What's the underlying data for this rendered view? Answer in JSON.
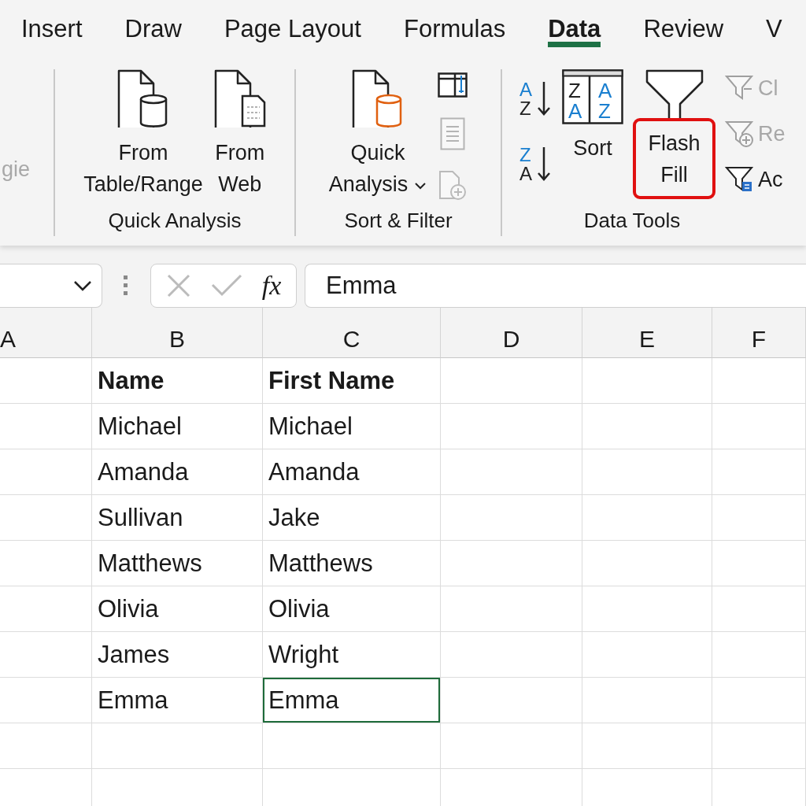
{
  "tabs": [
    {
      "label": "Insert",
      "selected": false
    },
    {
      "label": "Draw",
      "selected": false
    },
    {
      "label": "Page Layout",
      "selected": false
    },
    {
      "label": "Formulas",
      "selected": false
    },
    {
      "label": "Data",
      "selected": true
    },
    {
      "label": "Review",
      "selected": false
    },
    {
      "label": "V",
      "selected": false
    }
  ],
  "ribbon": {
    "left_fragment": {
      "label": "gie",
      "disabled": true
    },
    "groups": [
      {
        "label": "Quick Analysis",
        "buttons": [
          {
            "kind": "table",
            "lines": [
              "From",
              "Table/Range"
            ],
            "dropdown": false
          },
          {
            "kind": "web",
            "lines": [
              "From",
              "Web"
            ],
            "dropdown": false
          }
        ]
      },
      {
        "label": "Sort & Filter",
        "buttons": [
          {
            "kind": "query",
            "lines": [
              "Quick",
              "Analysis"
            ],
            "dropdown": true
          }
        ],
        "small_icons": [
          {
            "kind": "columns",
            "disabled": false
          },
          {
            "kind": "sheet",
            "disabled": true
          },
          {
            "kind": "refresh",
            "disabled": true
          }
        ]
      }
    ],
    "data_tools": {
      "label": "Data Tools",
      "sort_ascending": [
        "A",
        "Z"
      ],
      "sort_descending": [
        "Z",
        "A"
      ],
      "sort_button": {
        "icon_letters": [
          "Z",
          "A",
          "A",
          "Z"
        ],
        "label": "Sort"
      },
      "flash_fill": {
        "lines": [
          "Flash",
          "Fill"
        ],
        "highlighted": true
      },
      "filter_commands": [
        {
          "kind": "clear",
          "label": "Cl",
          "disabled": true
        },
        {
          "kind": "reapply",
          "label": "Re",
          "disabled": true
        },
        {
          "kind": "advanced",
          "label": "Ac",
          "disabled": false
        }
      ]
    }
  },
  "formula_bar": {
    "fx": "fx",
    "value": "Emma"
  },
  "sheet": {
    "columns": [
      "A",
      "B",
      "C",
      "D",
      "E",
      "F"
    ],
    "rows": [
      {
        "name": "Name",
        "first_name": "First Name",
        "bold": true,
        "first_name_selected": false
      },
      {
        "name": "Michael",
        "first_name": "Michael",
        "bold": false,
        "first_name_selected": false
      },
      {
        "name": "Amanda",
        "first_name": "Amanda",
        "bold": false,
        "first_name_selected": false
      },
      {
        "name": "Sullivan",
        "first_name": "Jake",
        "bold": false,
        "first_name_selected": false
      },
      {
        "name": "Matthews",
        "first_name": "Matthews",
        "bold": false,
        "first_name_selected": false
      },
      {
        "name": "Olivia",
        "first_name": "Olivia",
        "bold": false,
        "first_name_selected": false
      },
      {
        "name": "James",
        "first_name": "Wright",
        "bold": false,
        "first_name_selected": false
      },
      {
        "name": "Emma",
        "first_name": "Emma",
        "bold": false,
        "first_name_selected": true
      }
    ]
  }
}
